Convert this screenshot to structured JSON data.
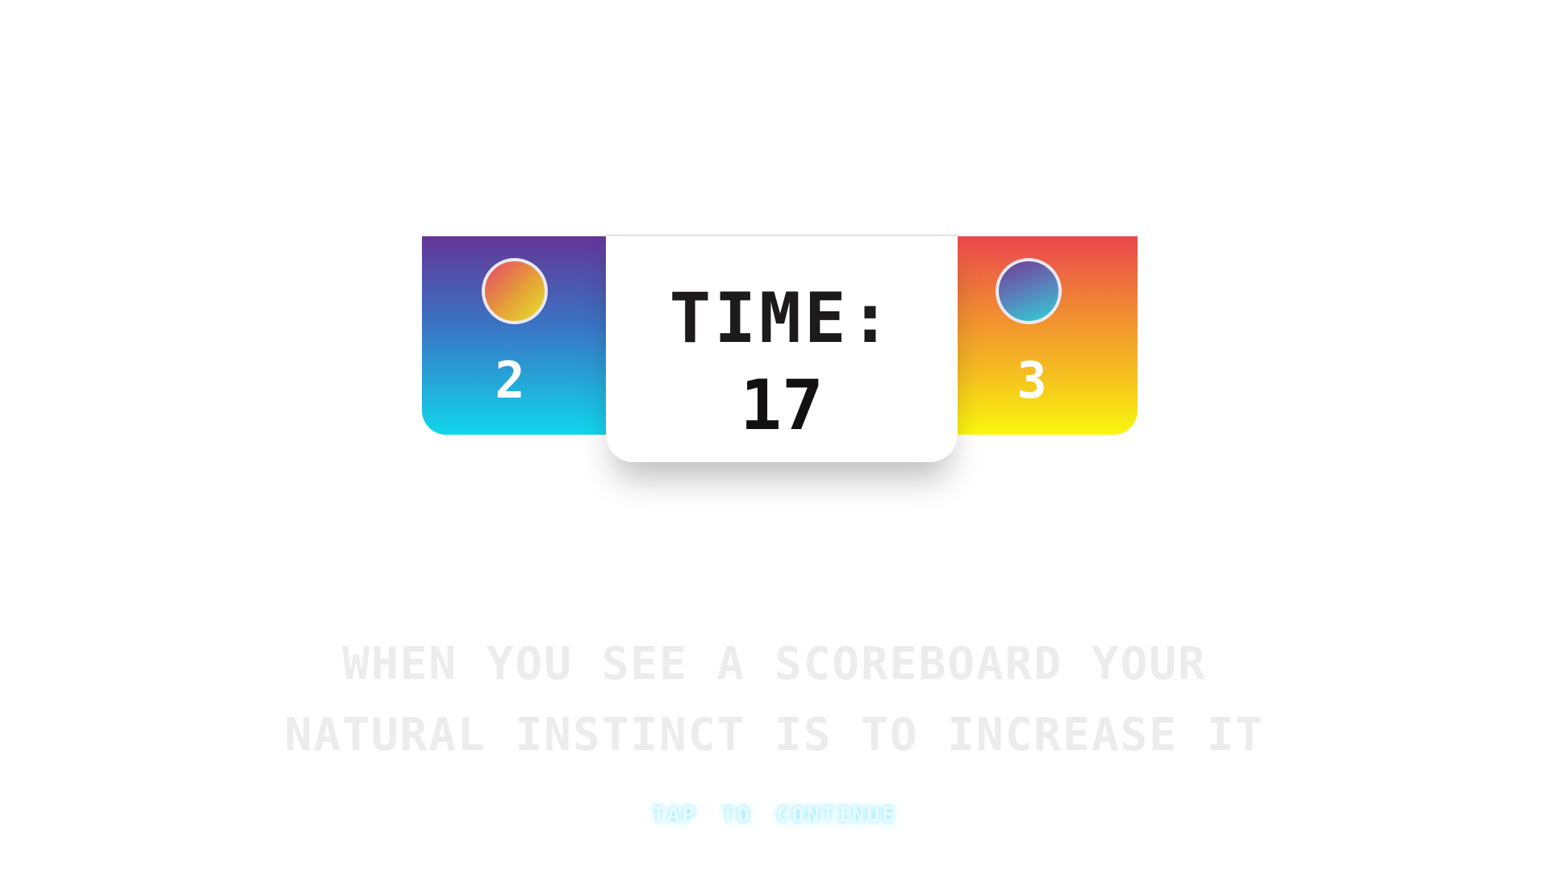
{
  "scoreboard": {
    "left_team": {
      "score": "2",
      "panel_colors": [
        "#633596",
        "#11d6eb"
      ]
    },
    "right_team": {
      "score": "3",
      "panel_colors": [
        "#ea4650",
        "#f9f80e"
      ]
    },
    "timer": {
      "label": "TIME:",
      "value": "17"
    }
  },
  "caption": {
    "line1": "WHEN YOU SEE A SCOREBOARD YOUR",
    "line2": "NATURAL INSTINCT IS TO INCREASE IT"
  },
  "prompt": {
    "label": "TAP TO CONTINUE"
  },
  "colors": {
    "background": "#ffffff",
    "caption_text": "#ececec",
    "prompt_glow": "#8ee8ff"
  }
}
